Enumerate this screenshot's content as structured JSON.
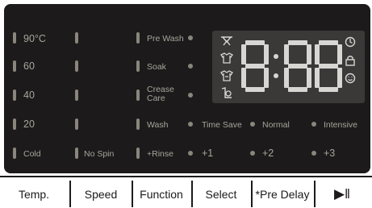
{
  "temperature": [
    "90°C",
    "60",
    "40",
    "20",
    "Cold"
  ],
  "spin": [
    "",
    "",
    "",
    "",
    "No Spin"
  ],
  "options_col1": [
    "Pre Wash",
    "Soak",
    "Crease Care",
    "Wash",
    "+Rinse"
  ],
  "time_options": [
    "Time Save",
    "Normal",
    "Intensive"
  ],
  "rinse_options": [
    "+1",
    "+2",
    "+3"
  ],
  "display": {
    "digits": "8:88"
  },
  "buttons": [
    "Temp.",
    "Speed",
    "Function",
    "Select",
    "*Pre Delay",
    "▶‖"
  ],
  "display_icons": [
    "child-lock-icon",
    "lock-icon",
    "smile-icon",
    "shirt-icon"
  ],
  "colors": {
    "panel": "#1c1a1a",
    "label": "#a9a49c",
    "display_bg": "#3b3938",
    "segment": "#d8d6d3"
  }
}
